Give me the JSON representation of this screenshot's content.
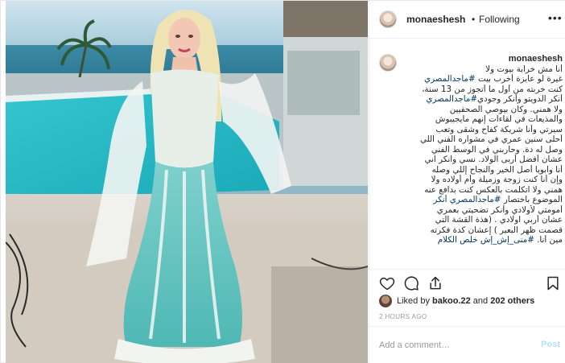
{
  "post": {
    "username": "monaeshesh",
    "follow_status": "Following",
    "separator": "•",
    "more_icon": "•••",
    "photo_alt": "Woman in a turquoise and white lace gown posing by a pool",
    "caption_user": "monaeshesh",
    "caption_lines": [
      {
        "text": "أنا مش خرابة بيوت ولا",
        "tag": ""
      },
      {
        "text": "غيرة لو عايزة أخرب بيت ",
        "tag": "#ماجدالمصري"
      },
      {
        "text": "كنت خربته من أول ما أتجوز من 13 سنة،",
        "tag": ""
      },
      {
        "text": " أنكر الدويتو وأنكر وجودي",
        "tag": "#ماجدالمصري"
      },
      {
        "text": "ولا همني. وكان بيوصي الصحفيين",
        "tag": ""
      },
      {
        "text": "والمذيعات في لقاءات إنهم مايجيبوش",
        "tag": ""
      },
      {
        "text": "سيرتي وأنا شريكة كفاح وشقى وتعب",
        "tag": ""
      },
      {
        "text": "أحلى سنين عمري في مشواره الفني اللي",
        "tag": ""
      },
      {
        "text": "وصل له دة. وحاربني في الوسط الفني",
        "tag": ""
      },
      {
        "text": "عشان أفضل أربى الولاد. نسي وانكر اني",
        "tag": ""
      },
      {
        "text": "أنا وابويا أصل الخير والنجاح إللي وصله",
        "tag": ""
      },
      {
        "text": "وإن أنا كنت زوجة وزميلة وأم أولاده ولا",
        "tag": ""
      },
      {
        "text": "همني ولا اتكلمت بالعكس كنت بدافع عنه",
        "tag": ""
      },
      {
        "text": "الموضوع باختصار ",
        "tag": "#ماجدالمصري أنكر"
      },
      {
        "text": "أمومتي لأولادي وأنكر تضحيتي بعمري",
        "tag": ""
      },
      {
        "text": "عشان أربي اولادي . (هذة القشة التي",
        "tag": ""
      },
      {
        "text": "قصمت ظهر البعير ) إعشان كدة فكرته",
        "tag": ""
      },
      {
        "text": "مين أنا. ",
        "tag": "#منى_إش_إش خلص الكلام"
      }
    ],
    "time": "2h",
    "likes_prefix": "Liked by",
    "likes_user": "bakoo.22",
    "likes_and": "and",
    "likes_count": "202 others",
    "posted_ago": "2 HOURS AGO",
    "comment_placeholder": "Add a comment…",
    "post_button": "Post",
    "colors": {
      "hashtag": "#003569",
      "muted": "#999999",
      "post_button": "#b2dffc",
      "text": "#262626"
    },
    "icons": [
      "heart-icon",
      "comment-icon",
      "share-icon",
      "bookmark-icon"
    ]
  }
}
